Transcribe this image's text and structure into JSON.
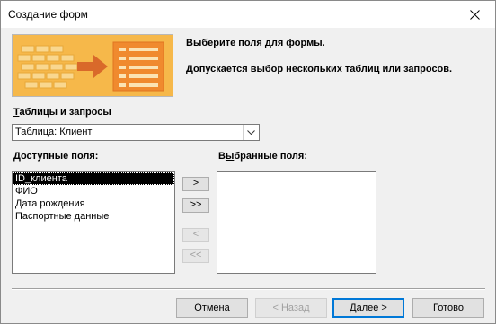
{
  "window": {
    "title": "Создание форм",
    "close_icon": "close-icon"
  },
  "banner": {
    "icon": "form-wizard-illustration",
    "colors": {
      "background": "#f6b84a",
      "arrow": "#d9692a",
      "panel": "#f08a2e"
    }
  },
  "instructions": {
    "line1": "Выберите поля для формы.",
    "line2": "Допускается выбор нескольких таблиц или запросов."
  },
  "tables_label": {
    "hotkey": "Т",
    "rest": "аблицы и запросы"
  },
  "tables_combo": {
    "value": "Таблица: Клиент",
    "arrow_icon": "chevron-down-icon"
  },
  "available_label": {
    "hotkey": "Д",
    "rest": "оступные поля:"
  },
  "selected_label": {
    "prefix": "В",
    "hotkey": "ы",
    "rest": "бранные поля:"
  },
  "available_fields": [
    "ID_клиента",
    "ФИО",
    "Дата рождения",
    "Паспортные данные"
  ],
  "selected_field_index": 0,
  "selected_fields": [],
  "move_buttons": {
    "add_one": ">",
    "add_all": ">>",
    "remove_one": "<",
    "remove_all": "<<"
  },
  "footer_buttons": {
    "cancel": "Отмена",
    "back": "< Назад",
    "next": "Далее >",
    "finish": "Готово"
  }
}
